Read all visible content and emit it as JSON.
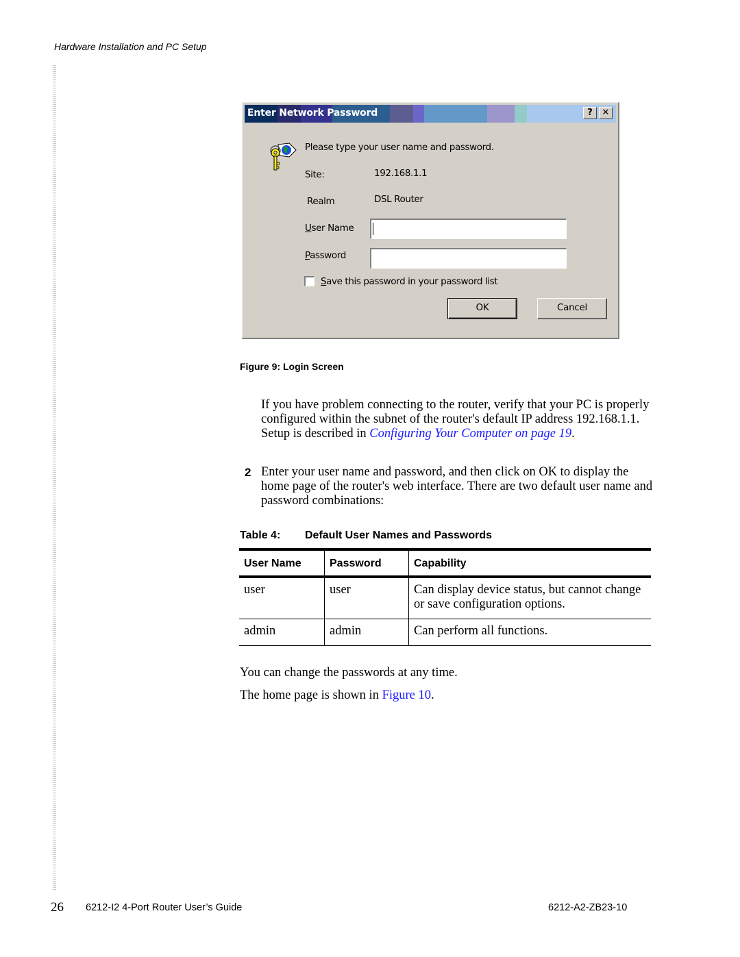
{
  "header": {
    "running_head": "Hardware Installation and PC Setup"
  },
  "dialog": {
    "title": "Enter Network Password",
    "help_button": "?",
    "close_button": "✕",
    "icon": "key-globe-icon",
    "prompt": "Please type your user name and password.",
    "site_label": "Site:",
    "site_value": "192.168.1.1",
    "realm_label": "Realm",
    "realm_value": "DSL Router",
    "user_name_label": {
      "accel": "U",
      "rest": "ser Name"
    },
    "user_name_value": "",
    "password_label": {
      "accel": "P",
      "rest": "assword"
    },
    "password_value": "",
    "save_password": {
      "accel": "S",
      "rest": "ave this password in your password list",
      "checked": false
    },
    "ok_label": "OK",
    "cancel_label": "Cancel"
  },
  "figure_caption": "Figure 9: Login Screen",
  "paragraph1": {
    "text": "If you have problem connecting to the router, verify that your PC is properly configured within the subnet of the router's default IP address 192.168.1.1. Setup is described in ",
    "link": "Configuring Your Computer on page 19",
    "end": "."
  },
  "step2": {
    "number": "2",
    "text": "Enter your user name and password, and then click on OK to display the home page of the router's web interface. There are two default user name and password combinations:"
  },
  "table": {
    "label": "Table 4:",
    "title": "Default User Names and Passwords",
    "columns": [
      "User Name",
      "Password",
      "Capability"
    ],
    "rows": [
      [
        "user",
        "user",
        "Can display device status, but cannot change or save configuration options."
      ],
      [
        "admin",
        "admin",
        "Can perform all functions."
      ]
    ]
  },
  "paragraph3": "You can change the passwords at any time.",
  "paragraph4": {
    "text": "The home page is shown in ",
    "link": "Figure 10",
    "end": "."
  },
  "footer": {
    "page_number": "26",
    "guide_title": "6212-I2 4-Port Router User’s Guide",
    "doc_code": "6212-A2-ZB23-10"
  }
}
